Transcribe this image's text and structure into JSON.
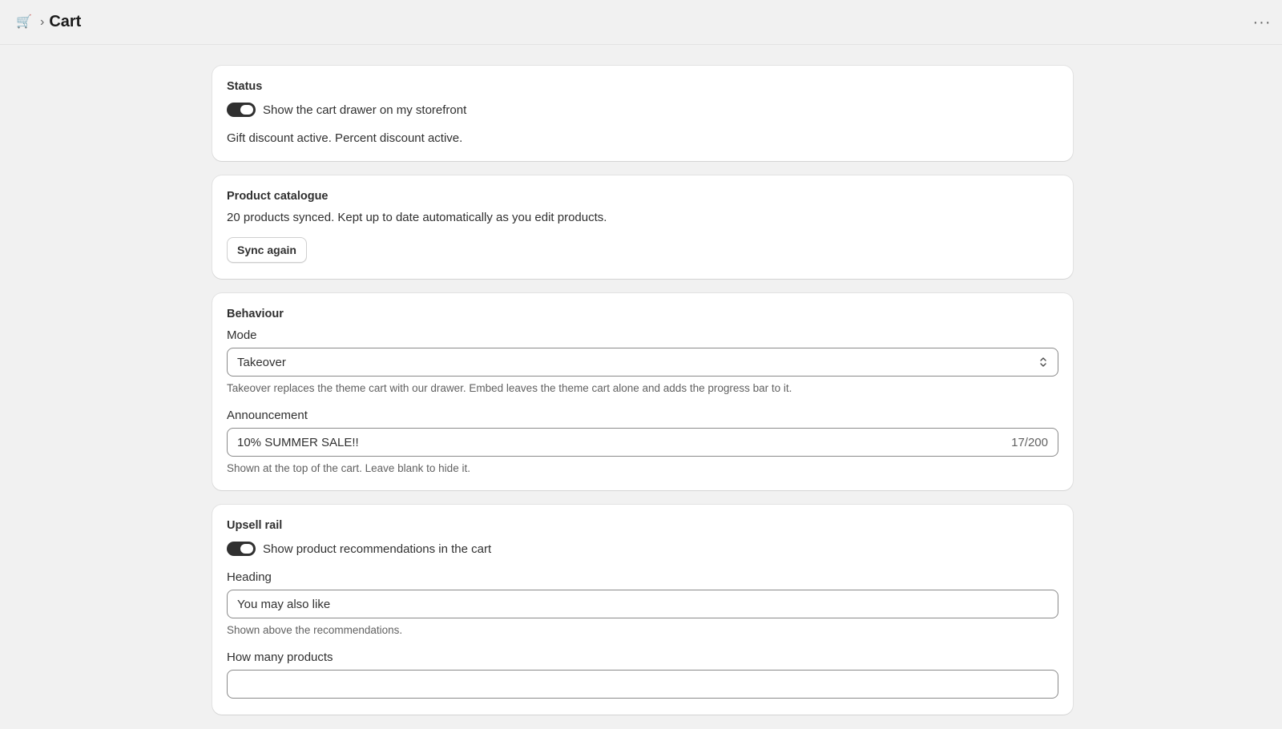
{
  "header": {
    "logo_icon": "shopping-cart-icon",
    "separator": "›",
    "title": "Cart",
    "more_label": "···"
  },
  "status": {
    "title": "Status",
    "toggle_label": "Show the cart drawer on my storefront",
    "toggle_on": true,
    "message": "Gift discount active. Percent discount active."
  },
  "catalogue": {
    "title": "Product catalogue",
    "message": "20 products synced. Kept up to date automatically as you edit products.",
    "button_label": "Sync again"
  },
  "behaviour": {
    "title": "Behaviour",
    "mode_label": "Mode",
    "mode_value": "Takeover",
    "mode_help": "Takeover replaces the theme cart with our drawer. Embed leaves the theme cart alone and adds the progress bar to it.",
    "announcement_label": "Announcement",
    "announcement_value": "10% SUMMER SALE!!",
    "announcement_counter": "17/200",
    "announcement_help": "Shown at the top of the cart. Leave blank to hide it."
  },
  "upsell": {
    "title": "Upsell rail",
    "toggle_label": "Show product recommendations in the cart",
    "toggle_on": true,
    "heading_label": "Heading",
    "heading_value": "You may also like",
    "heading_help": "Shown above the recommendations.",
    "count_label": "How many products"
  },
  "colors": {
    "background": "#f1f1f1",
    "card": "#ffffff",
    "toggle_on": "#303030",
    "text": "#303030",
    "muted": "#616161"
  }
}
